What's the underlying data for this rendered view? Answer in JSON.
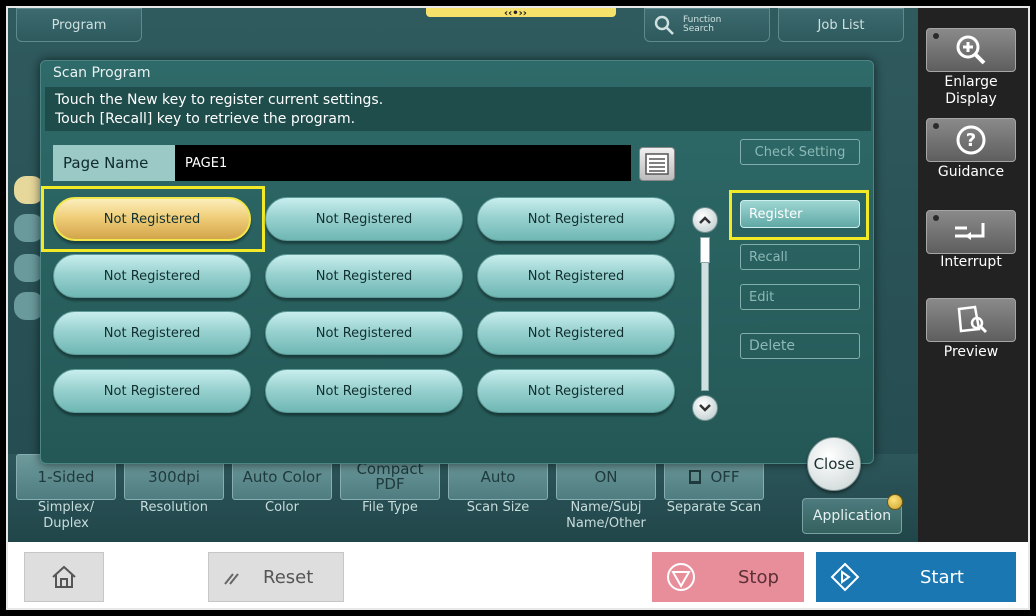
{
  "background": {
    "top_tabs": {
      "program": "Program",
      "function_search_line1": "Function",
      "function_search_line2": "Search",
      "job_list": "Job List"
    },
    "settings": [
      {
        "value": "1-Sided",
        "label": "Simplex/\nDuplex"
      },
      {
        "value": "300dpi",
        "label": "Resolution"
      },
      {
        "value": "Auto Color",
        "label": "Color"
      },
      {
        "value": "Compact PDF",
        "label": "File Type"
      },
      {
        "value": "Auto",
        "label": "Scan Size"
      },
      {
        "value": "ON",
        "label": "Name/Subj\nName/Other"
      },
      {
        "value": "OFF",
        "label": "Separate Scan"
      }
    ],
    "application": "Application"
  },
  "right_panel": {
    "enlarge_display": "Enlarge Display",
    "guidance": "Guidance",
    "interrupt": "Interrupt",
    "preview": "Preview"
  },
  "modal": {
    "title": "Scan Program",
    "message_line1": "Touch the New key to register current settings.",
    "message_line2": "Touch [Recall] key to retrieve the program.",
    "page_name_label": "Page Name",
    "page_name_value": "PAGE1",
    "programs": [
      "Not Registered",
      "Not Registered",
      "Not Registered",
      "Not Registered",
      "Not Registered",
      "Not Registered",
      "Not Registered",
      "Not Registered",
      "Not Registered",
      "Not Registered",
      "Not Registered",
      "Not Registered"
    ],
    "check_setting": "Check Setting",
    "register": "Register",
    "recall": "Recall",
    "edit": "Edit",
    "delete": "Delete",
    "close": "Close"
  },
  "bottom_bar": {
    "reset": "Reset",
    "stop": "Stop",
    "start": "Start"
  },
  "colors": {
    "highlight": "#f2ea26",
    "stop": "#e88e9b",
    "start": "#1a77b2"
  }
}
